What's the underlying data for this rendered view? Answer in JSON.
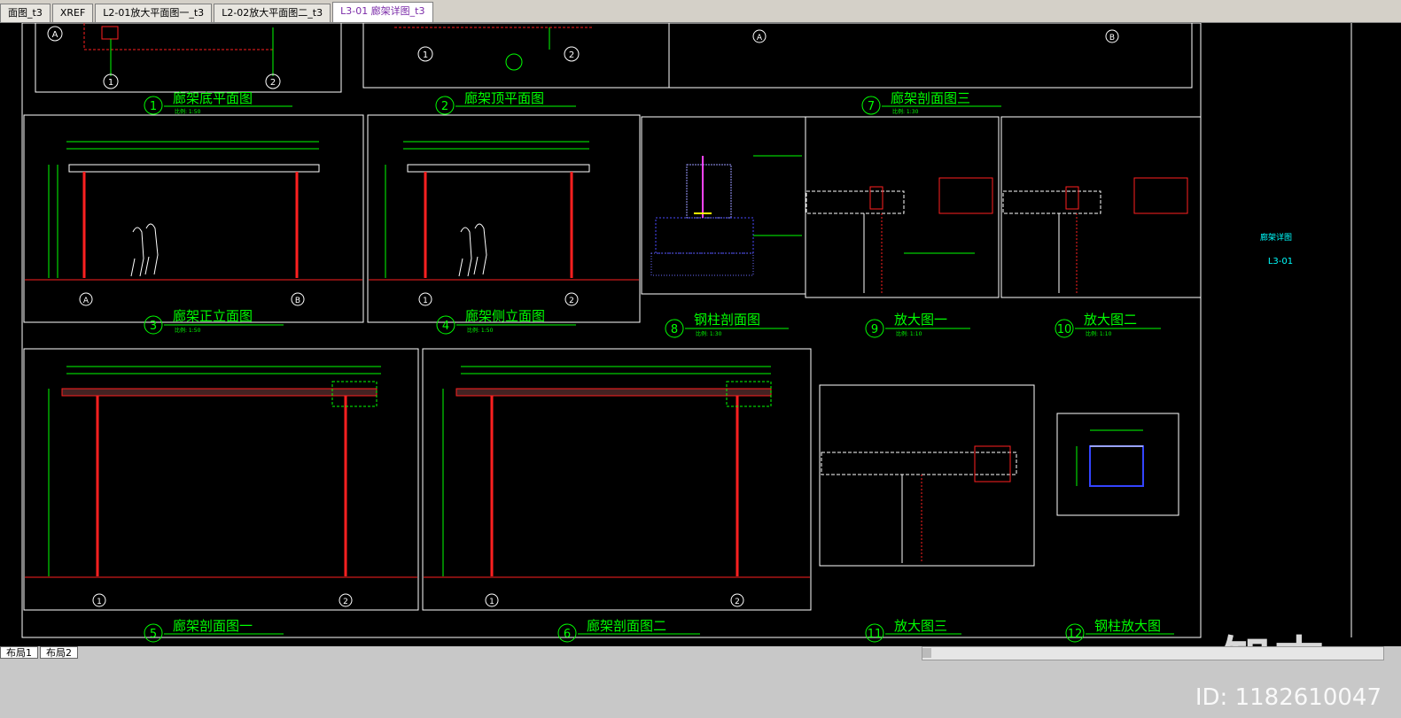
{
  "tabs": [
    {
      "label": "面图_t3"
    },
    {
      "label": "XREF"
    },
    {
      "label": "L2-01放大平面图一_t3"
    },
    {
      "label": "L2-02放大平面图二_t3"
    },
    {
      "label": "L3-01 廊架详图_t3",
      "active": true
    }
  ],
  "layout_tabs": [
    "布局1",
    "布局2"
  ],
  "drawing": {
    "views": [
      {
        "num": "1",
        "title": "廊架底平面图",
        "scale": "比例: 1:50"
      },
      {
        "num": "2",
        "title": "廊架顶平面图",
        "scale": ""
      },
      {
        "num": "7",
        "title": "廊架剖面图三",
        "scale": "比例: 1:30"
      },
      {
        "num": "3",
        "title": "廊架正立面图",
        "scale": "比例: 1:50"
      },
      {
        "num": "4",
        "title": "廊架侧立面图",
        "scale": "比例: 1:50"
      },
      {
        "num": "8",
        "title": "钢柱剖面图",
        "scale": "比例: 1:30"
      },
      {
        "num": "9",
        "title": "放大图一",
        "scale": "比例: 1:10"
      },
      {
        "num": "10",
        "title": "放大图二",
        "scale": "比例: 1:10"
      },
      {
        "num": "5",
        "title": "廊架剖面图一",
        "scale": ""
      },
      {
        "num": "6",
        "title": "廊架剖面图二",
        "scale": ""
      },
      {
        "num": "11",
        "title": "放大图三",
        "scale": ""
      },
      {
        "num": "12",
        "title": "钢柱放大图",
        "scale": ""
      }
    ],
    "grid_axes": {
      "a": "A",
      "b": "B",
      "one": "1",
      "two": "2"
    },
    "titleblock": {
      "sheet_name": "廊架详图",
      "sheet_no": "L3-01"
    }
  },
  "watermark": {
    "logo": "知末",
    "id": "ID: 1182610047"
  },
  "colors": {
    "bg": "#000000",
    "line_green": "#00ff00",
    "line_white": "#ffffff",
    "line_red": "#ff2020",
    "ui_gray": "#d4d0c8"
  }
}
